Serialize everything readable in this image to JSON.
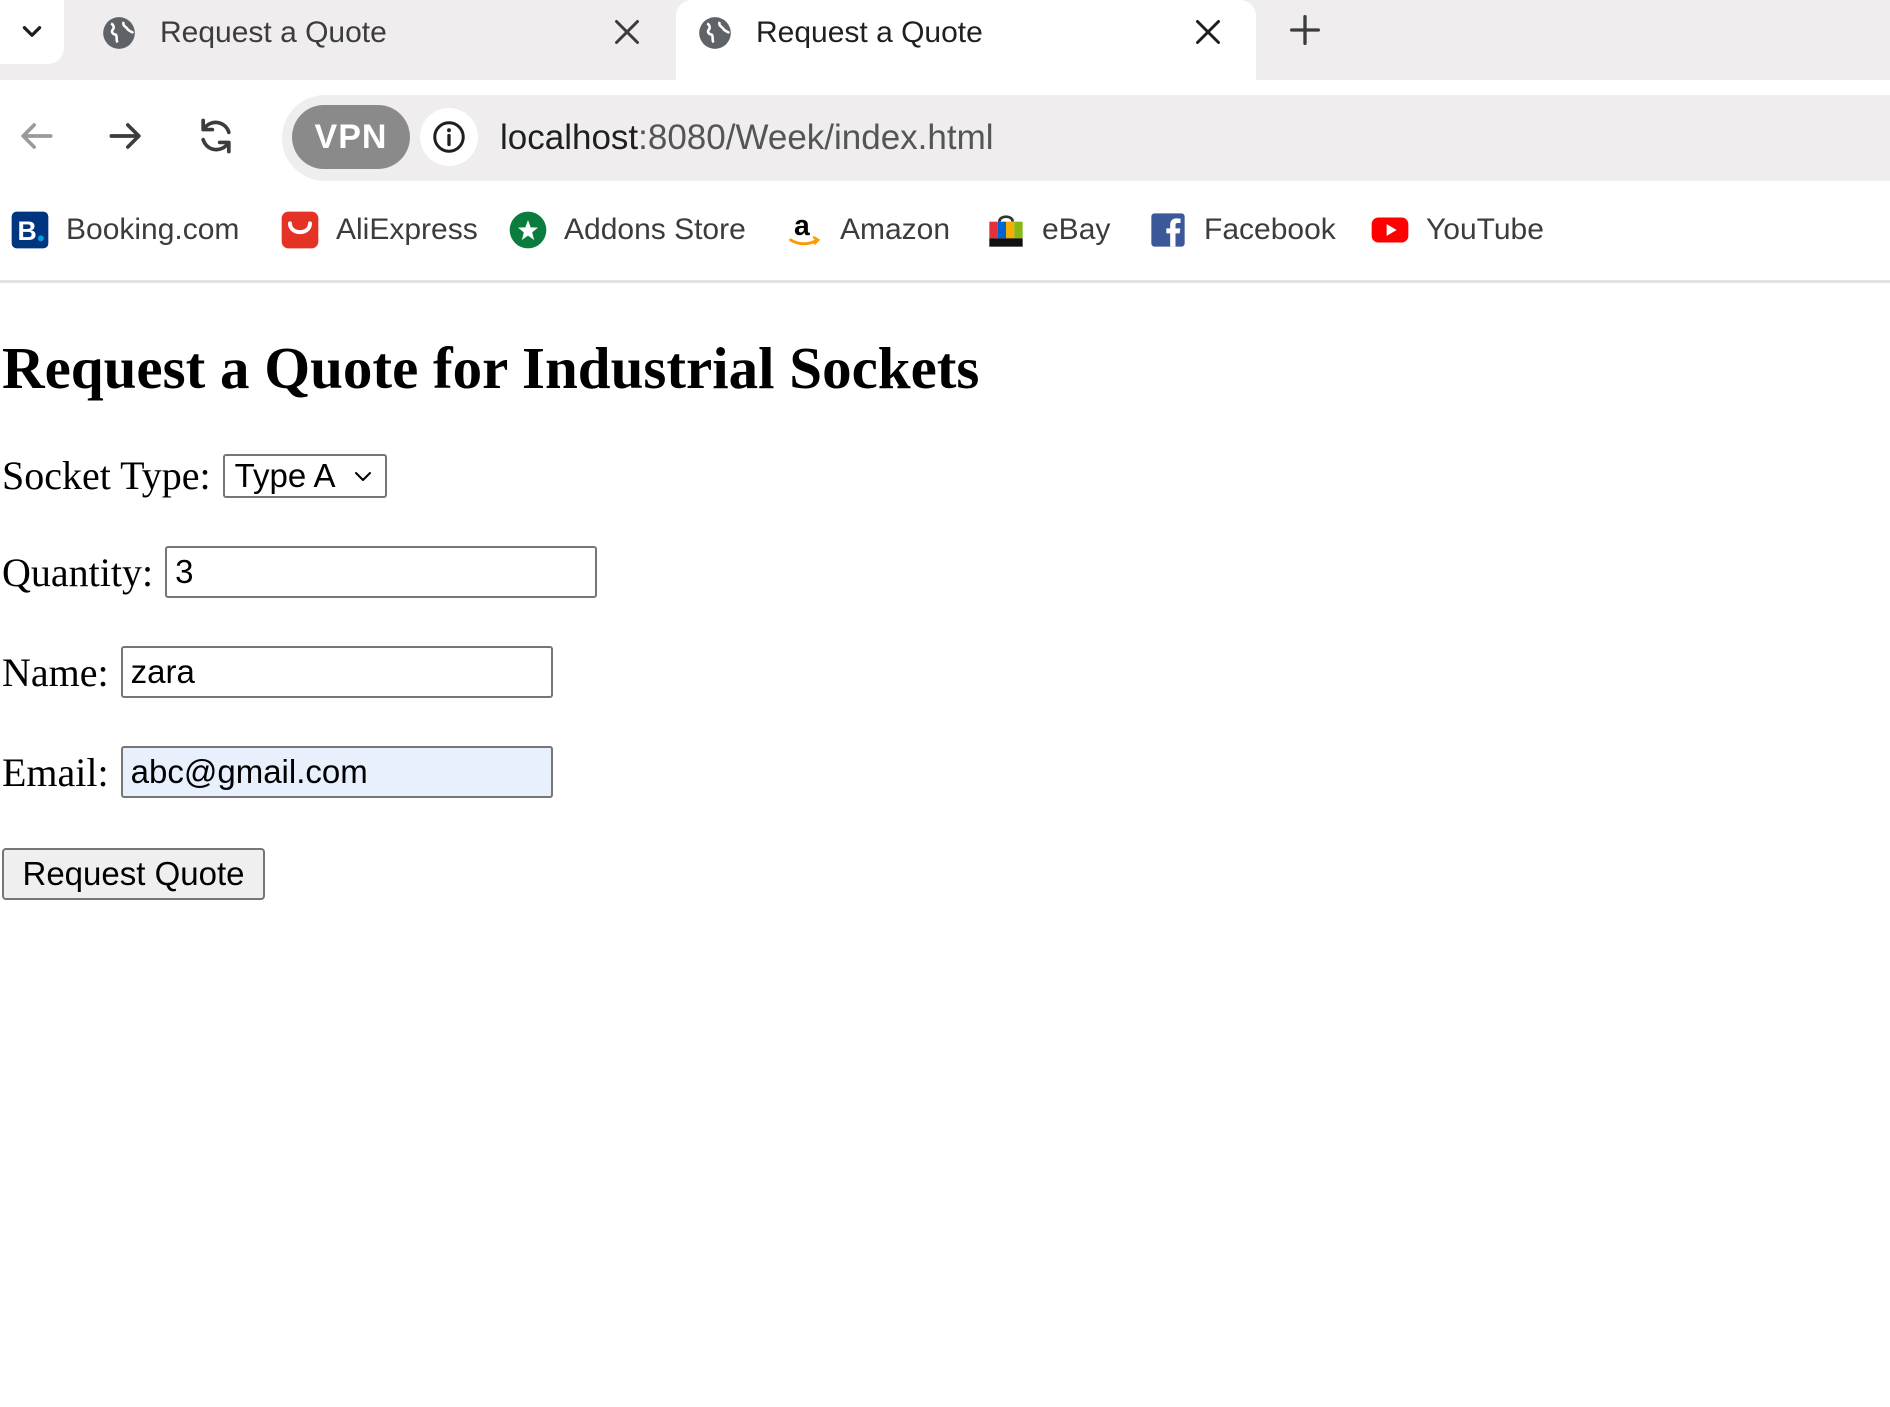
{
  "browser": {
    "tabs": [
      {
        "title": "Request a Quote",
        "active": false
      },
      {
        "title": "Request a Quote",
        "active": true
      }
    ],
    "vpn_label": "VPN",
    "url_host": "localhost",
    "url_path": ":8080/Week/index.html",
    "bookmarks": [
      {
        "label": "Booking.com",
        "icon": "booking-icon",
        "color": "#003580"
      },
      {
        "label": "AliExpress",
        "icon": "aliexpress-icon",
        "color": "#e43225"
      },
      {
        "label": "Addons Store",
        "icon": "addons-store-icon",
        "color": "#0a7c3e"
      },
      {
        "label": "Amazon",
        "icon": "amazon-icon",
        "color": "#000000"
      },
      {
        "label": "eBay",
        "icon": "ebay-icon",
        "color": "#e53238"
      },
      {
        "label": "Facebook",
        "icon": "facebook-icon",
        "color": "#3b5998"
      },
      {
        "label": "YouTube",
        "icon": "youtube-icon",
        "color": "#ff0000"
      }
    ]
  },
  "page": {
    "title": "Request a Quote for Industrial Sockets",
    "socket_type_label": "Socket Type:",
    "socket_type_value": "Type A",
    "quantity_label": "Quantity:",
    "quantity_value": "3",
    "name_label": "Name:",
    "name_value": "zara",
    "email_label": "Email:",
    "email_value": "abc@gmail.com",
    "submit_label": "Request Quote"
  }
}
